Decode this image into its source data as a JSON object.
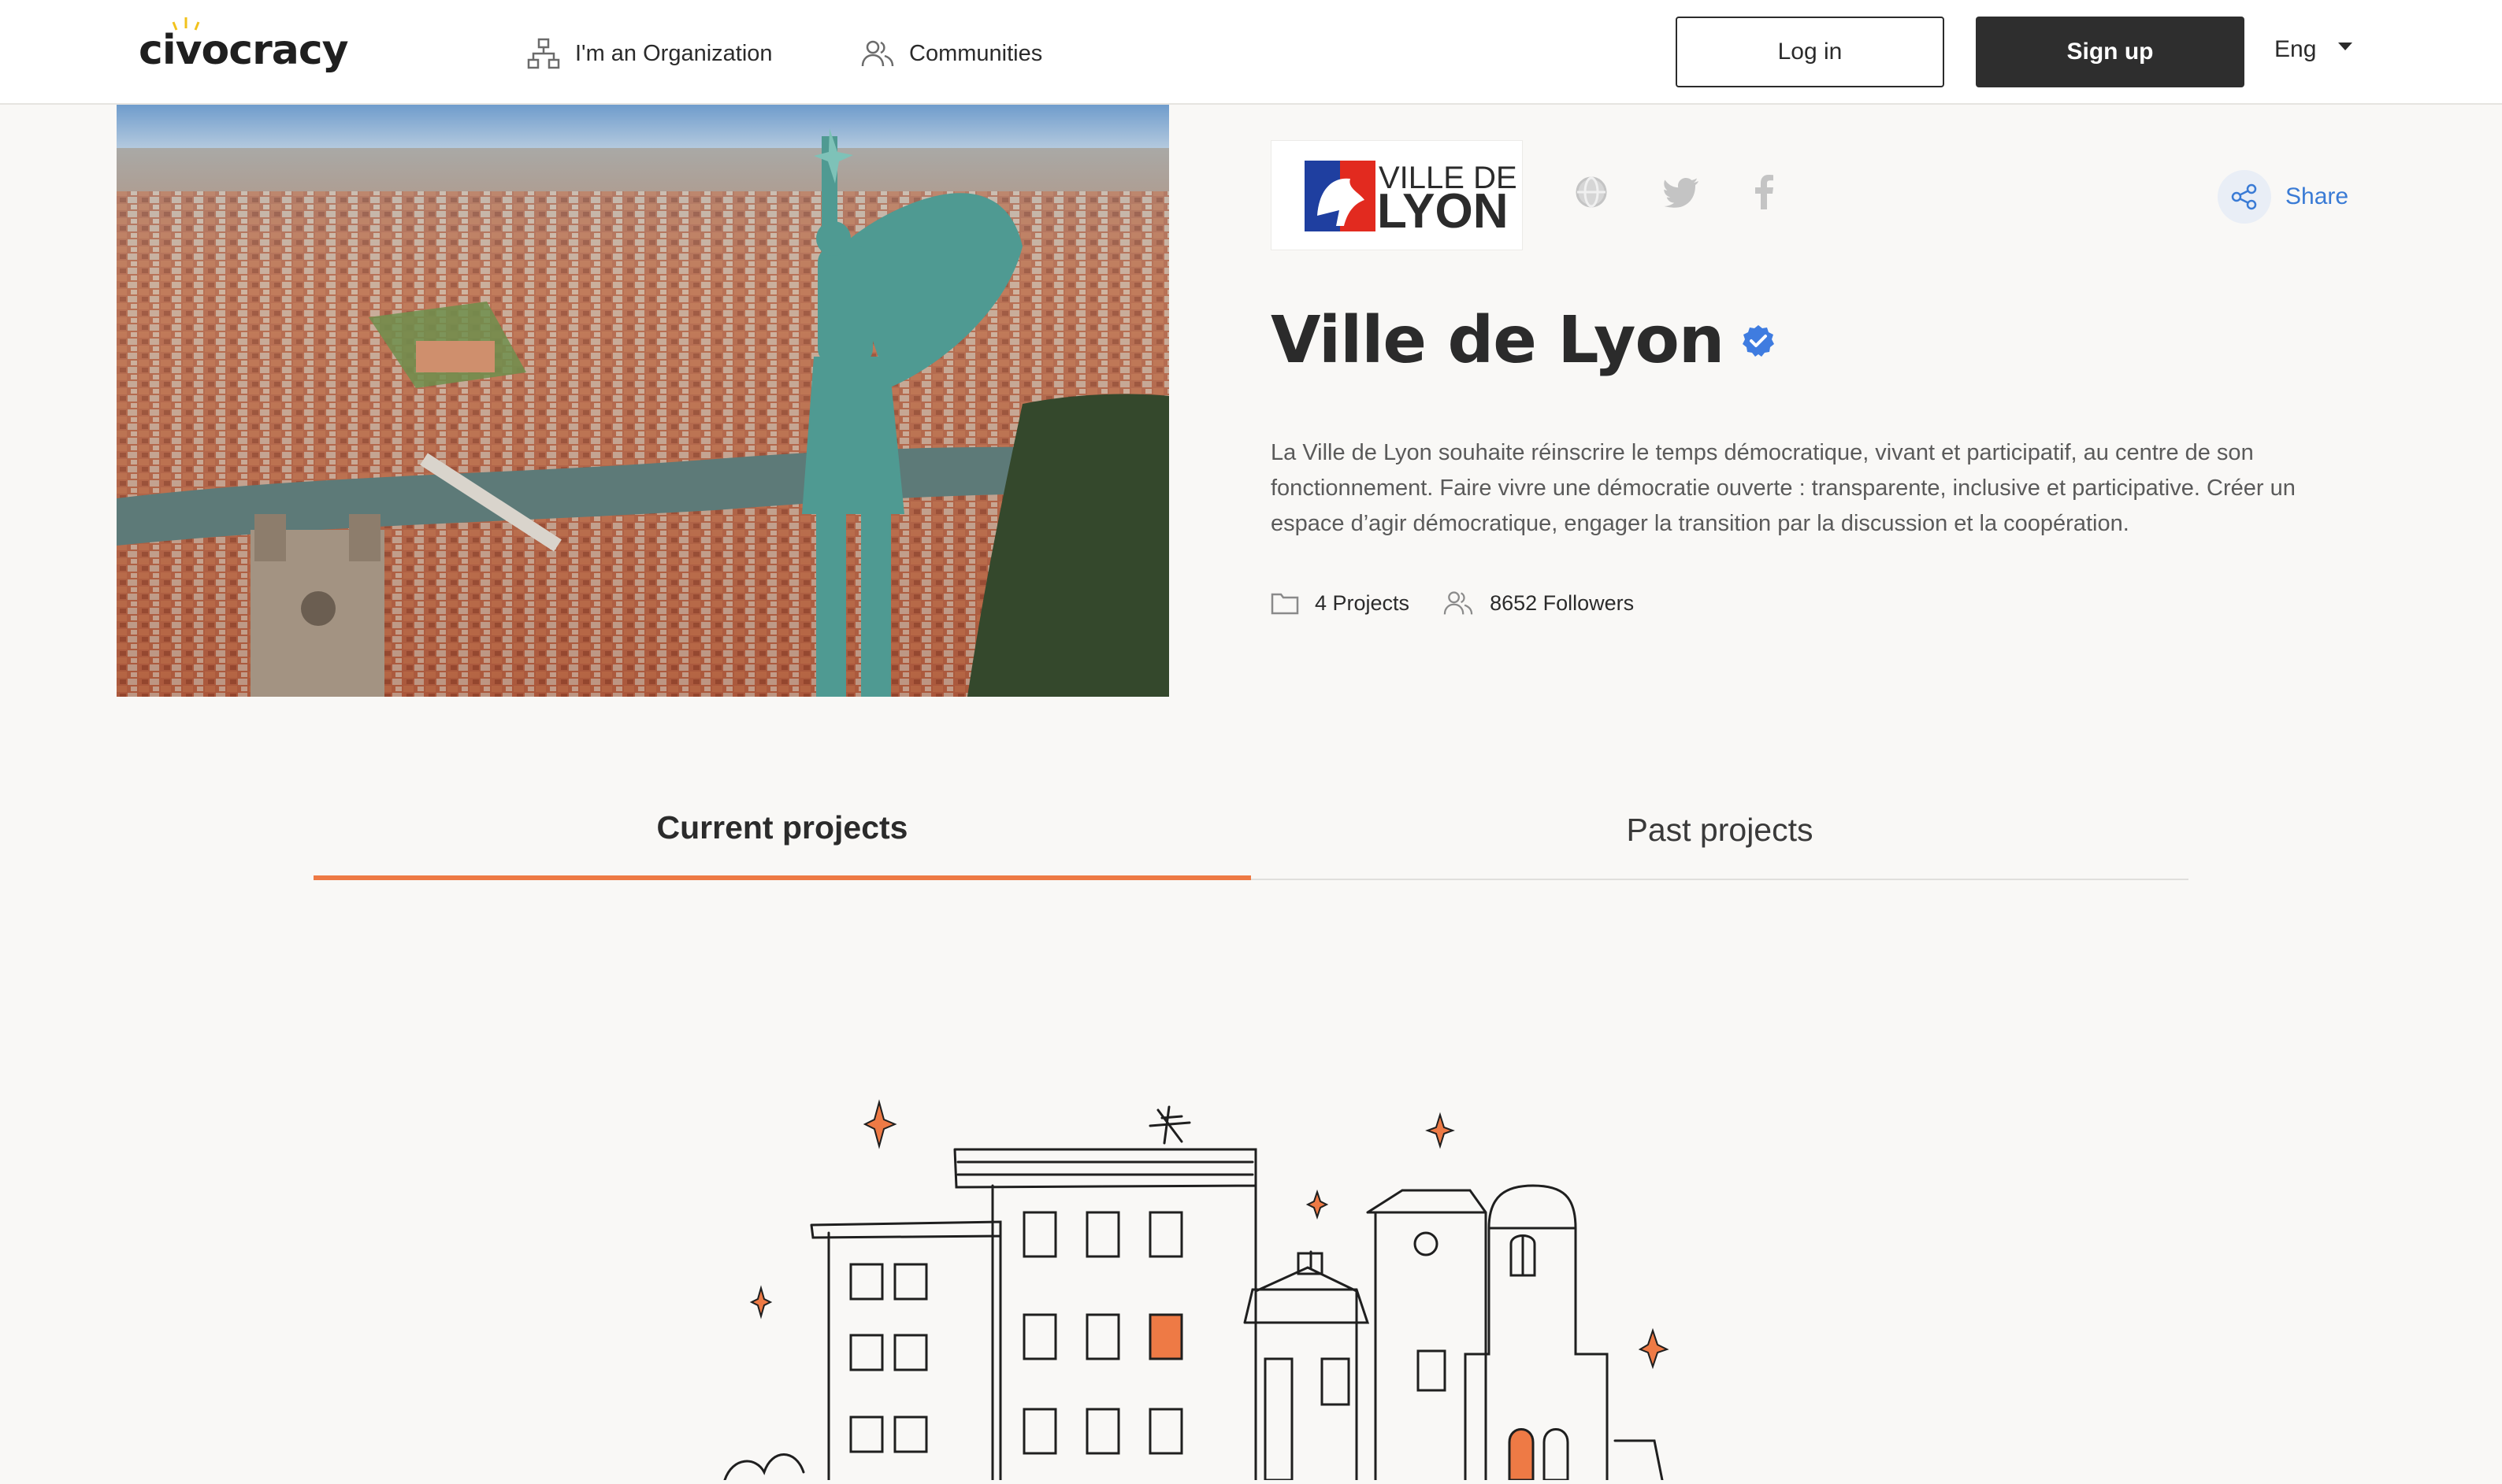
{
  "header": {
    "logo_text": "civocracy",
    "nav": [
      {
        "label": "I'm an Organization",
        "icon": "org-chart-icon"
      },
      {
        "label": "Communities",
        "icon": "people-icon"
      }
    ],
    "login_label": "Log in",
    "signup_label": "Sign up",
    "language": "Eng"
  },
  "org": {
    "logo_line1": "VILLE DE",
    "logo_line2": "LYON",
    "name": "Ville de Lyon",
    "verified": true,
    "description": "La Ville de Lyon souhaite réinscrire le temps démocratique, vivant et participatif, au centre de son fonctionnement. Faire vivre une démocratie ouverte : transparente, inclusive et participative. Créer un espace d’agir démocratique, engager la transition par la discussion et la coopération.",
    "projects": "4 Projects",
    "followers": "8652 Followers",
    "share_label": "Share",
    "social_icons": [
      "globe-icon",
      "twitter-icon",
      "facebook-icon"
    ]
  },
  "tabs": [
    {
      "label": "Current projects",
      "active": true
    },
    {
      "label": "Past projects",
      "active": false
    }
  ],
  "colors": {
    "accent": "#ee7a45",
    "link": "#3a7bd5",
    "dark_button": "#2e2e2e",
    "background": "#f9f8f6"
  }
}
